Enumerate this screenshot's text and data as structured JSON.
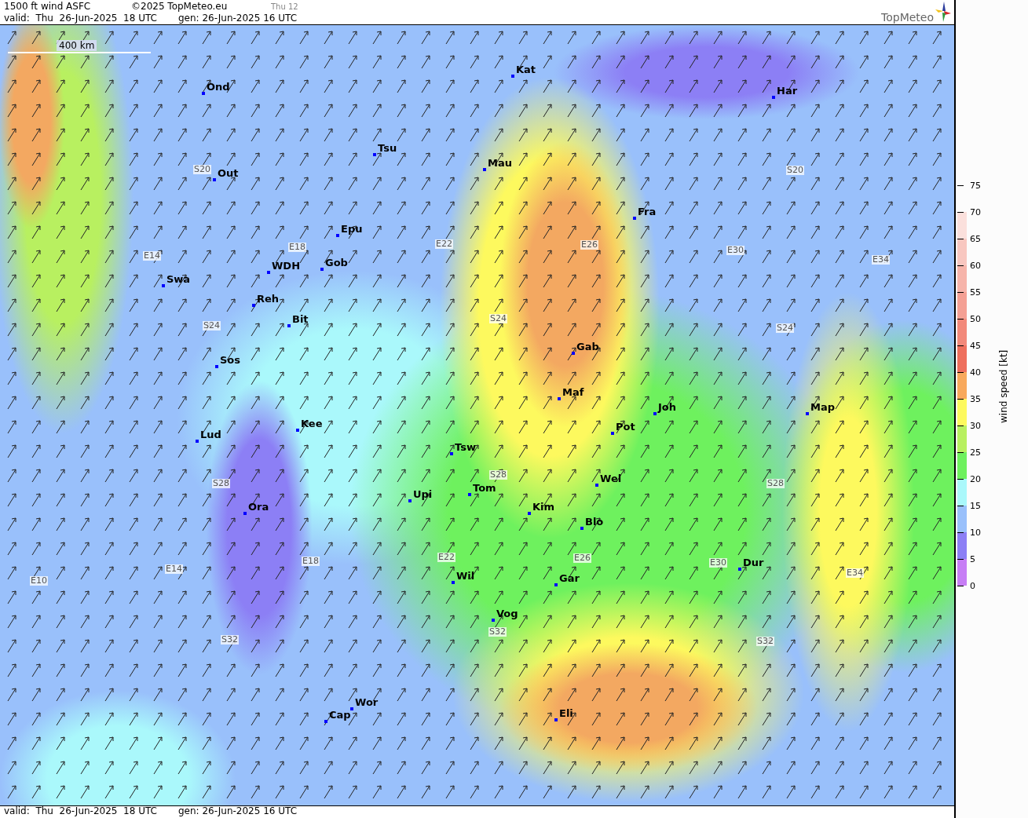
{
  "header": {
    "title": "1500 ft wind ASFC",
    "copyright": "©2025 TopMeteo.eu",
    "step": "Thu 12",
    "valid": "valid:  Thu  26-Jun-2025  18 UTC",
    "generated": "gen: 26-Jun-2025 16 UTC",
    "logo": "TopMeteo"
  },
  "map": {
    "scale": "400 km",
    "cities": [
      {
        "name": "Kat"
      },
      {
        "name": "Ond"
      },
      {
        "name": "Har"
      },
      {
        "name": "Tsu"
      },
      {
        "name": "Mau"
      },
      {
        "name": "Out"
      },
      {
        "name": "Fra"
      },
      {
        "name": "Epu"
      },
      {
        "name": "WDH"
      },
      {
        "name": "Gob"
      },
      {
        "name": "Swa"
      },
      {
        "name": "Reh"
      },
      {
        "name": "Bit"
      },
      {
        "name": "Gab"
      },
      {
        "name": "Sos"
      },
      {
        "name": "Maf"
      },
      {
        "name": "Joh"
      },
      {
        "name": "Map"
      },
      {
        "name": "Kee"
      },
      {
        "name": "Pot"
      },
      {
        "name": "Lud"
      },
      {
        "name": "Tsw"
      },
      {
        "name": "Wel"
      },
      {
        "name": "Upi"
      },
      {
        "name": "Tom"
      },
      {
        "name": "Kim"
      },
      {
        "name": "Ora"
      },
      {
        "name": "Blo"
      },
      {
        "name": "Dur"
      },
      {
        "name": "Wil"
      },
      {
        "name": "Gar"
      },
      {
        "name": "Vog"
      },
      {
        "name": "Wor"
      },
      {
        "name": "Cap"
      },
      {
        "name": "Eli"
      }
    ],
    "grid_labels": [
      "S20",
      "S20",
      "E14",
      "E18",
      "E22",
      "E26",
      "E30",
      "E34",
      "S24",
      "S24",
      "S24",
      "S28",
      "S28",
      "S28",
      "E10",
      "E14",
      "E18",
      "E22",
      "E26",
      "E30",
      "E34",
      "S32",
      "S32",
      "S32"
    ]
  },
  "legend": {
    "title": "wind speed [kt]",
    "ticks": [
      "75",
      "70",
      "65",
      "60",
      "55",
      "50",
      "45",
      "40",
      "35",
      "30",
      "25",
      "20",
      "15",
      "10",
      "5",
      "0"
    ],
    "bands": [
      {
        "color": "#c77ef5"
      },
      {
        "color": "#8c7ff5"
      },
      {
        "color": "#99c0fb"
      },
      {
        "color": "#aaf8fb"
      },
      {
        "color": "#6ef15e"
      },
      {
        "color": "#b8f060"
      },
      {
        "color": "#fdf95e"
      },
      {
        "color": "#f8a95c"
      },
      {
        "color": "#ee6f5d"
      },
      {
        "color": "#f2897a"
      },
      {
        "color": "#f4a094"
      },
      {
        "color": "#f6b4aa"
      },
      {
        "color": "#f8c7c0"
      },
      {
        "color": "#fbe0dc"
      }
    ]
  },
  "footer": {
    "valid": "valid:  Thu  26-Jun-2025  18 UTC",
    "generated": "gen: 26-Jun-2025 16 UTC"
  }
}
